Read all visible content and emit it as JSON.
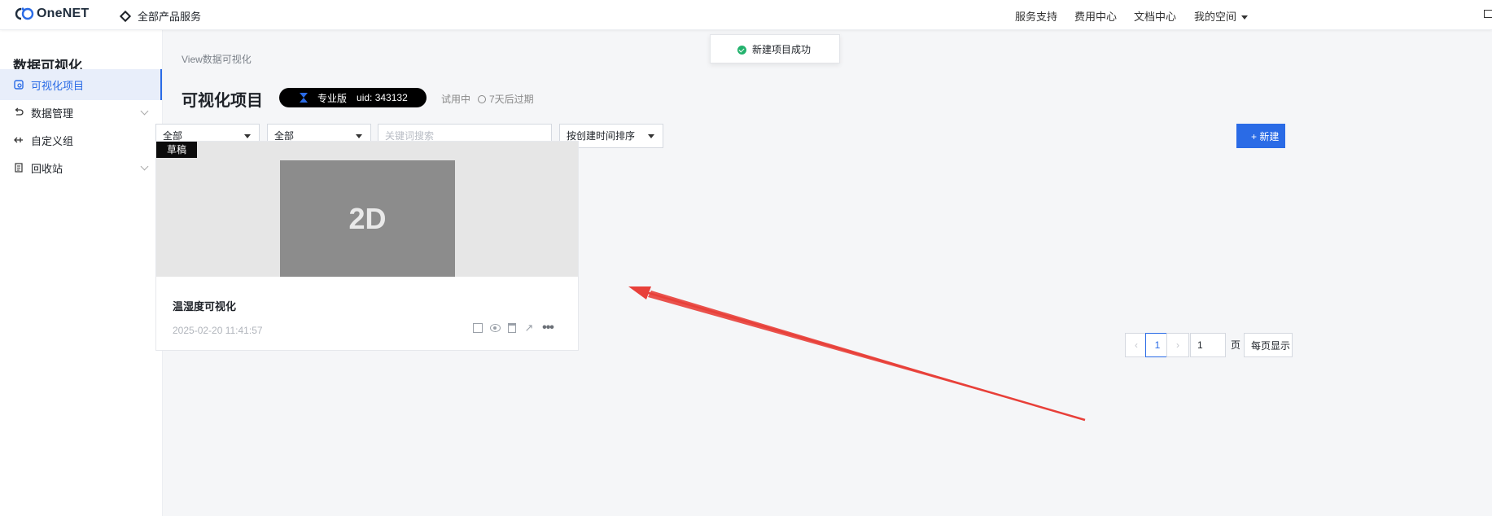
{
  "header": {
    "brand": "OneNET",
    "all_products": "全部产品服务",
    "nav": [
      "服务支持",
      "费用中心",
      "文档中心",
      "我的空间"
    ]
  },
  "sidebar": {
    "title": "数据可视化",
    "items": [
      {
        "label": "可视化项目",
        "icon": "dashboard-icon",
        "active": true
      },
      {
        "label": "数据管理",
        "icon": "undo-icon",
        "expandable": true
      },
      {
        "label": "自定义组",
        "icon": "component-icon"
      },
      {
        "label": "回收站",
        "icon": "document-icon",
        "expandable": true
      }
    ]
  },
  "main": {
    "breadcrumb": "View数据可视化",
    "title": "可视化项目",
    "badge": {
      "edition": "专业版",
      "uid": "uid: 343132"
    },
    "trial": "试用中",
    "expire": "7天后过期",
    "filters": {
      "type": "全部",
      "status": "全部",
      "search_placeholder": "关键词搜索",
      "sort": "按创建时间排序"
    },
    "new_button": "+ 新建",
    "card": {
      "tag": "草稿",
      "thumb_text": "2D",
      "title": "温湿度可视化",
      "date": "2025-02-20 11:41:57",
      "actions": [
        "edit-icon",
        "preview-icon",
        "delete-icon",
        "share-icon",
        "more-icon"
      ]
    },
    "pagination": {
      "prev": "‹",
      "current": "1",
      "next": "›",
      "jump_value": "1",
      "page_label": "页",
      "page_size": "每页显示"
    }
  },
  "toast": {
    "text": "新建项目成功",
    "status": "success"
  },
  "colors": {
    "accent": "#2a6be6",
    "success": "#23b26d",
    "annotation": "#e8403a"
  }
}
